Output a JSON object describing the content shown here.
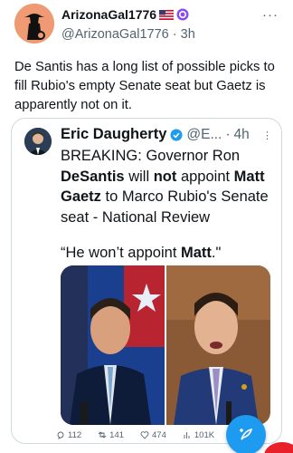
{
  "post": {
    "author_name": "ArizonaGal1776",
    "author_handle": "@ArizonaGal1776",
    "separator": "·",
    "time": "3h",
    "more": "···",
    "text": "De Santis has a long list of possible picks to fill Rubio's empty Senate seat but Gaetz is apparently not on it.",
    "badges": [
      "us-flag-emoji",
      "purple-verified-icon"
    ]
  },
  "quote": {
    "author_name": "Eric Daugherty",
    "author_handle": "@E...",
    "separator": "·",
    "time": "4h",
    "more": "⋮",
    "text_parts": {
      "p1": "BREAKING: Governor Ron ",
      "b1": "DeSantis",
      "p2": " will ",
      "b2": "not",
      "p3": " appoint ",
      "b3": "Matt Gaetz",
      "p4": " to Marco Rubio's Senate seat - National Review"
    },
    "quote_parts": {
      "q1": "“He won’t appoint ",
      "q2": "Matt",
      "q3": ".\""
    }
  },
  "actions": {
    "replies": "112",
    "reposts": "141",
    "likes": "474",
    "views": "101K"
  },
  "colors": {
    "accent": "#1d9bf0",
    "text": "#0f1419",
    "muted": "#536471",
    "border": "#cfd9de"
  }
}
